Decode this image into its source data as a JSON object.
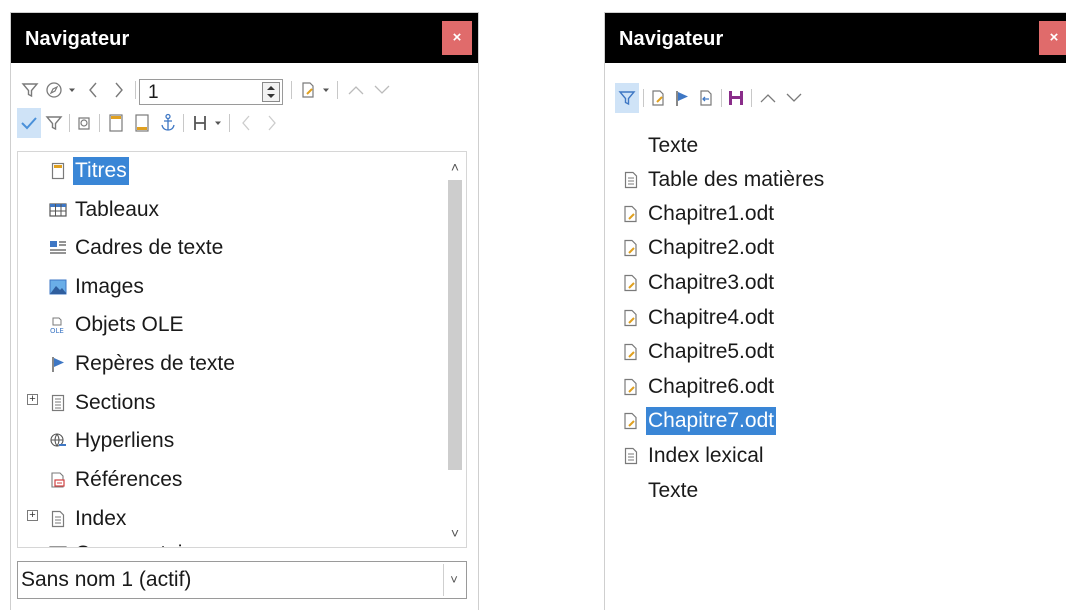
{
  "left_panel": {
    "title": "Navigateur",
    "close_label": "×",
    "page_number": "1",
    "tree_items": [
      {
        "label": "Titres",
        "icon": "headings-icon",
        "selected": true
      },
      {
        "label": "Tableaux",
        "icon": "table-icon"
      },
      {
        "label": "Cadres de texte",
        "icon": "text-frame-icon"
      },
      {
        "label": "Images",
        "icon": "image-icon"
      },
      {
        "label": "Objets OLE",
        "icon": "ole-object-icon"
      },
      {
        "label": "Repères de texte",
        "icon": "bookmark-icon"
      },
      {
        "label": "Sections",
        "icon": "section-icon",
        "expandable": true
      },
      {
        "label": "Hyperliens",
        "icon": "hyperlink-icon"
      },
      {
        "label": "Références",
        "icon": "reference-icon"
      },
      {
        "label": "Index",
        "icon": "index-icon",
        "expandable": true
      },
      {
        "label": "Commentaires",
        "icon": "comment-icon"
      }
    ],
    "expander_symbol": "+",
    "scroll_up": "˄",
    "scroll_down": "˅",
    "document_select": "Sans nom 1 (actif)",
    "dropdown_arrow": "˅"
  },
  "right_panel": {
    "title": "Navigateur",
    "close_label": "×",
    "tree_items": [
      {
        "label": "Texte",
        "icon": ""
      },
      {
        "label": "Table des matières",
        "icon": "document-icon"
      },
      {
        "label": "Chapitre1.odt",
        "icon": "linked-file-icon"
      },
      {
        "label": "Chapitre2.odt",
        "icon": "linked-file-icon"
      },
      {
        "label": "Chapitre3.odt",
        "icon": "linked-file-icon"
      },
      {
        "label": "Chapitre4.odt",
        "icon": "linked-file-icon"
      },
      {
        "label": "Chapitre5.odt",
        "icon": "linked-file-icon"
      },
      {
        "label": "Chapitre6.odt",
        "icon": "linked-file-icon"
      },
      {
        "label": "Chapitre7.odt",
        "icon": "linked-file-icon",
        "selected": true
      },
      {
        "label": "Index lexical",
        "icon": "document-icon"
      },
      {
        "label": "Texte",
        "icon": ""
      }
    ]
  },
  "colors": {
    "titlebar": "#000000",
    "close_button": "#e06b6b",
    "selection": "#3a86d6",
    "toggle_active": "#cfe3f7",
    "icon_gray": "#7a7a7a",
    "icon_blue": "#3e77c4",
    "checkmark_blue": "#4a90d9",
    "save_purple": "#8a2d8a"
  }
}
